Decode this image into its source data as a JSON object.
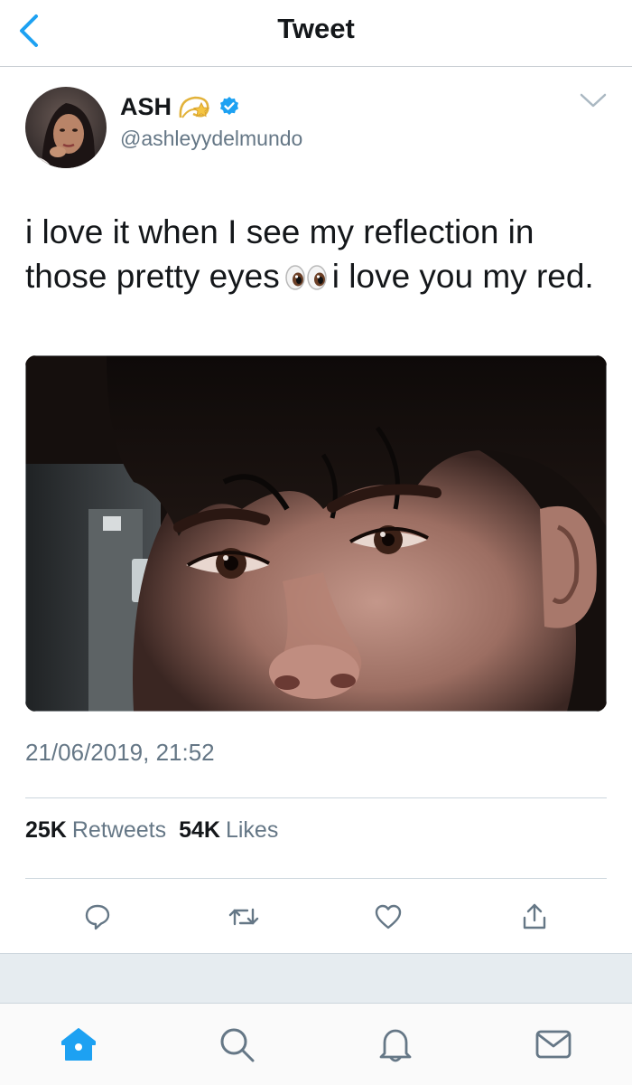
{
  "header": {
    "title": "Tweet",
    "back_icon": "chevron-left-icon"
  },
  "author": {
    "name": "ASH",
    "name_emoji": "dizzy-star-icon",
    "verified_icon": "verified-badge-icon",
    "handle": "@ashleyydelmundo"
  },
  "tweet": {
    "text_part1": "i love it when I see my reflection in those pretty eyes",
    "text_emoji": "eyes-emoji-icon",
    "text_part2": "i love you my red."
  },
  "timestamp": "21/06/2019, 21:52",
  "stats": {
    "retweets_count": "25K",
    "retweets_label": "Retweets",
    "likes_count": "54K",
    "likes_label": "Likes"
  },
  "actions": [
    "reply-icon",
    "retweet-icon",
    "like-icon",
    "share-icon"
  ],
  "tabbar": [
    "home-icon",
    "search-icon",
    "notifications-icon",
    "messages-icon"
  ],
  "colors": {
    "accent": "#1da1f2",
    "text_primary": "#14171a",
    "text_secondary": "#657786",
    "divider": "#ccd6dd",
    "band": "#e6ecf0"
  }
}
